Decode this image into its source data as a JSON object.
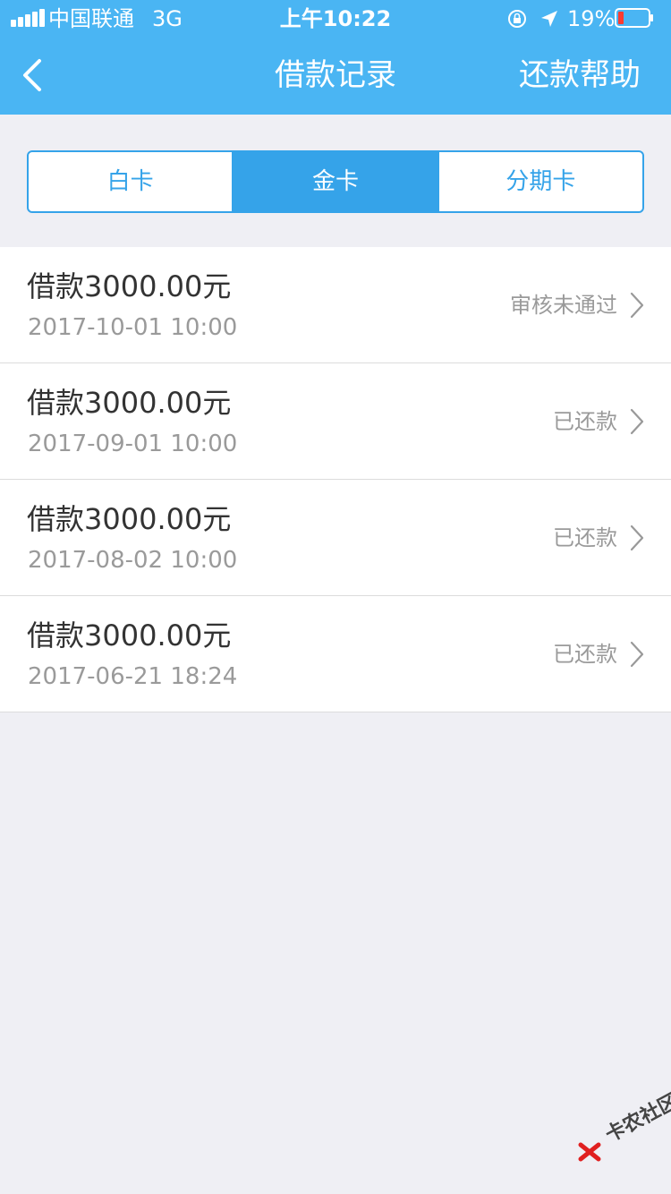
{
  "status_bar": {
    "carrier": "中国联通",
    "network": "3G",
    "time": "上午10:22",
    "battery": "19%"
  },
  "nav": {
    "title": "借款记录",
    "help": "还款帮助",
    "back_icon": "chevron-left-icon"
  },
  "tabs": [
    {
      "label": "白卡",
      "active": false
    },
    {
      "label": "金卡",
      "active": true
    },
    {
      "label": "分期卡",
      "active": false
    }
  ],
  "records": [
    {
      "amount": "借款3000.00元",
      "date": "2017-10-01 10:00",
      "status": "审核未通过"
    },
    {
      "amount": "借款3000.00元",
      "date": "2017-09-01 10:00",
      "status": "已还款"
    },
    {
      "amount": "借款3000.00元",
      "date": "2017-08-02 10:00",
      "status": "已还款"
    },
    {
      "amount": "借款3000.00元",
      "date": "2017-06-21 18:24",
      "status": "已还款"
    }
  ],
  "watermark": {
    "text": "卡农社区"
  },
  "colors": {
    "header": "#4ab5f3",
    "accent": "#35a3e9",
    "battery_low": "#ff3b30"
  }
}
